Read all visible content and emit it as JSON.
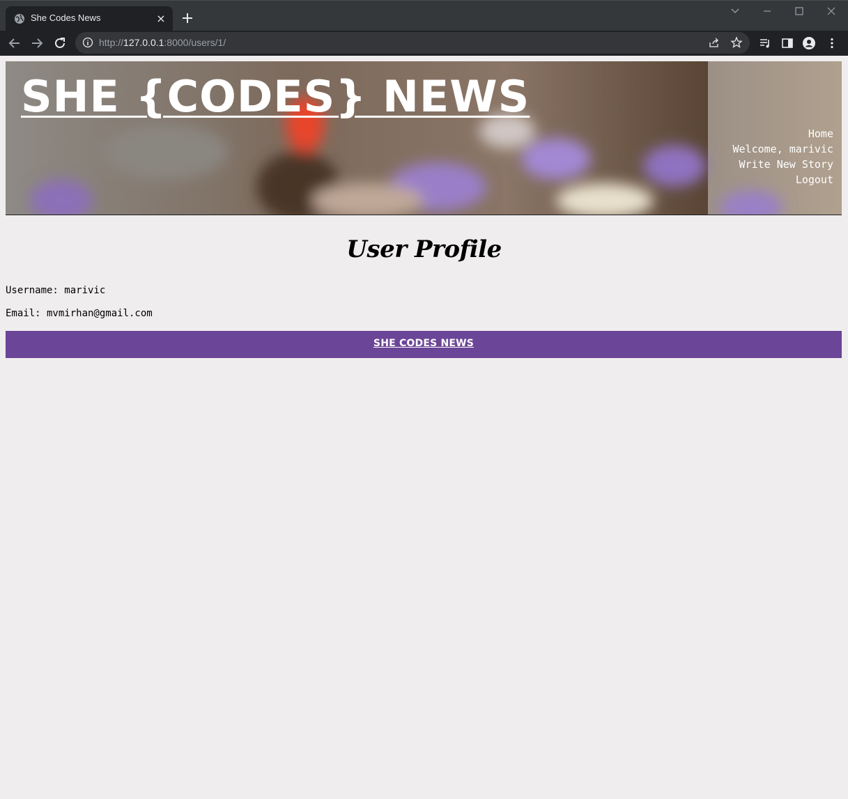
{
  "browser": {
    "tab_title": "She Codes News",
    "tab_close": "×",
    "url_scheme": "http://",
    "url_host": "127.0.0.1",
    "url_path": ":8000/users/1/"
  },
  "banner": {
    "site_title": "SHE {CODES} NEWS",
    "nav": [
      "Home",
      "Welcome, marivic",
      "Write New Story",
      "Logout"
    ]
  },
  "profile": {
    "heading": "User Profile",
    "username_line": "Username: marivic",
    "email_line": "Email: mvmirhan@gmail.com"
  },
  "footer": {
    "link": "SHE CODES NEWS"
  },
  "colors": {
    "accent_purple": "#6b4597",
    "page_background": "#f0edee",
    "browser_dark": "#202124"
  }
}
